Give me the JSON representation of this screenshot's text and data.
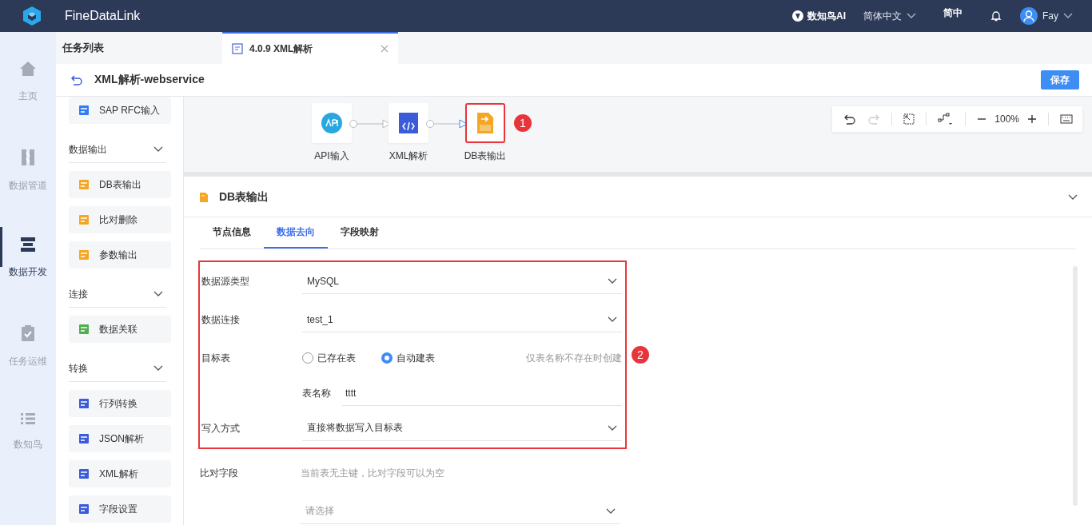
{
  "topbar": {
    "app_name": "FineDataLink",
    "ai_label": "数知鸟AI",
    "language": "简体中文",
    "short_lang": "简中",
    "user": "Fay"
  },
  "nav": [
    {
      "label": "主页",
      "selected": false
    },
    {
      "label": "数据管道",
      "selected": false
    },
    {
      "label": "数据开发",
      "selected": true
    },
    {
      "label": "任务运维",
      "selected": false
    },
    {
      "label": "数知鸟",
      "selected": false
    }
  ],
  "tab_bar": {
    "list_label": "任务列表",
    "tabs": [
      {
        "label": "4.0.9 XML解析",
        "selected": true
      }
    ]
  },
  "task": {
    "title": "XML解析-webservice",
    "save": "保存"
  },
  "palette": [
    {
      "kind": "item",
      "label": "SAP RFC输入"
    },
    {
      "kind": "group",
      "label": "数据输出",
      "expanded": true
    },
    {
      "kind": "item",
      "label": "DB表输出"
    },
    {
      "kind": "item",
      "label": "比对删除"
    },
    {
      "kind": "item",
      "label": "参数输出"
    },
    {
      "kind": "group",
      "label": "连接",
      "expanded": true
    },
    {
      "kind": "item",
      "label": "数据关联"
    },
    {
      "kind": "group",
      "label": "转换",
      "expanded": true
    },
    {
      "kind": "item",
      "label": "行列转换"
    },
    {
      "kind": "item",
      "label": "JSON解析"
    },
    {
      "kind": "item",
      "label": "XML解析"
    },
    {
      "kind": "item",
      "label": "字段设置"
    }
  ],
  "canvas": {
    "nodes": [
      {
        "label": "API输入",
        "selected": false
      },
      {
        "label": "XML解析",
        "selected": false
      },
      {
        "label": "DB表输出",
        "selected": true
      }
    ],
    "annotation": "1",
    "zoom": "100%"
  },
  "panel": {
    "title": "DB表输出",
    "expanded": true,
    "tabs": [
      {
        "label": "节点信息",
        "selected": false
      },
      {
        "label": "数据去向",
        "selected": true
      },
      {
        "label": "字段映射",
        "selected": false
      }
    ],
    "annotation": "2",
    "fields": [
      {
        "kind": "select",
        "label": "数据源类型",
        "value": "MySQL"
      },
      {
        "kind": "select",
        "label": "数据连接",
        "value": "test_1"
      },
      {
        "kind": "radio",
        "label": "目标表",
        "options": [
          {
            "label": "已存在表",
            "selected": false
          },
          {
            "label": "自动建表",
            "selected": true
          }
        ],
        "hint": "仅表名称不存在时创建"
      },
      {
        "kind": "text",
        "sublabel": "表名称",
        "value": "tttt"
      },
      {
        "kind": "select",
        "label": "写入方式",
        "value": "直接将数据写入目标表"
      }
    ],
    "compare": {
      "label": "比对字段",
      "hint": "当前表无主键，比对字段可以为空",
      "placeholder": "请选择"
    }
  }
}
